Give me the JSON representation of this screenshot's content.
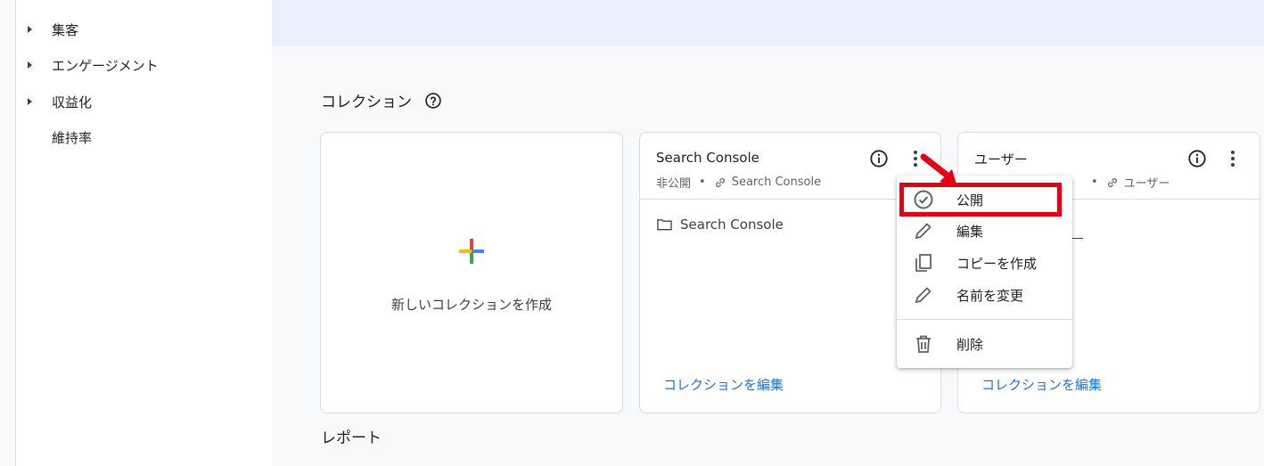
{
  "sidebar": {
    "items": [
      {
        "label": "集客",
        "expandable": true
      },
      {
        "label": "エンゲージメント",
        "expandable": true
      },
      {
        "label": "収益化",
        "expandable": true
      },
      {
        "label": "維持率",
        "expandable": false
      }
    ]
  },
  "collections": {
    "title": "コレクション",
    "new_card_label": "新しいコレクションを作成",
    "cards": [
      {
        "title": "Search Console",
        "status": "非公開",
        "source": "Search Console",
        "folder": "Search Console",
        "edit_link": "コレクションを編集"
      },
      {
        "title": "ユーザー",
        "source": "ユーザー",
        "partial_text": "性",
        "edit_link": "コレクションを編集"
      }
    ]
  },
  "context_menu": {
    "items": [
      {
        "label": "公開",
        "icon": "check-circle-icon"
      },
      {
        "label": "編集",
        "icon": "pencil-icon"
      },
      {
        "label": "コピーを作成",
        "icon": "copy-icon"
      },
      {
        "label": "名前を変更",
        "icon": "pencil-icon"
      },
      {
        "label": "削除",
        "icon": "trash-icon"
      }
    ]
  },
  "reports": {
    "title": "レポート"
  },
  "colors": {
    "banner": "#e8f0fe",
    "link": "#1a73e8",
    "highlight": "#e60012",
    "plus_red": "#ea4335",
    "plus_blue": "#4285f4",
    "plus_green": "#34a853",
    "plus_yellow": "#fbbc04"
  }
}
